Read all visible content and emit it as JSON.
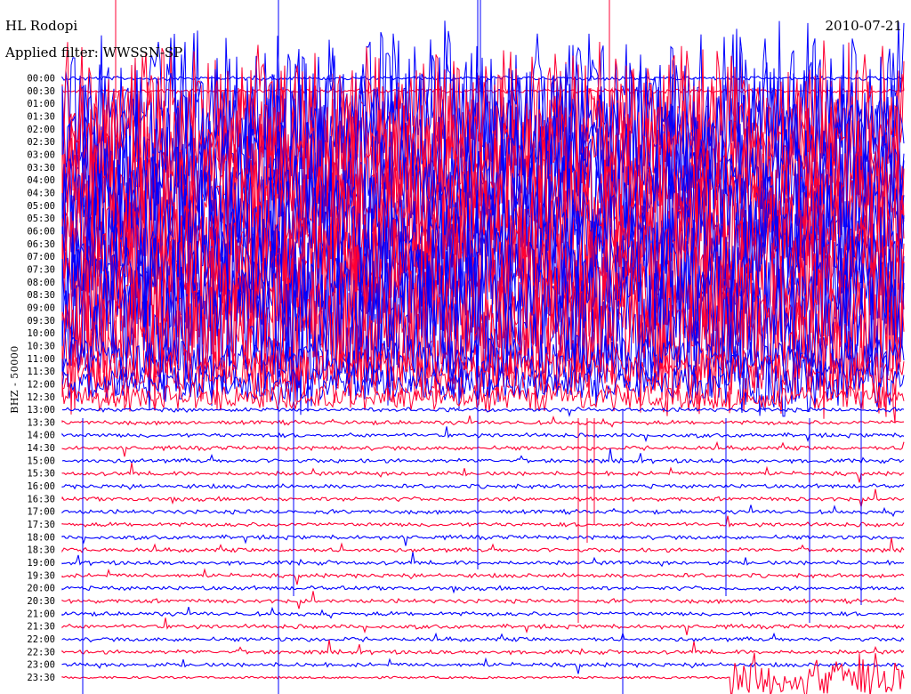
{
  "header": {
    "station": "HL Rodopi",
    "date": "2010-07-21",
    "filter": "Applied filter: WWSSN-SP",
    "channel": "BHZ - 50000"
  },
  "colors": {
    "odd_trace": "#0000ff",
    "even_trace": "#ff0033",
    "text": "#000000"
  },
  "chart_data": {
    "type": "line",
    "title": "HL Rodopi",
    "subtitle": "Applied filter: WWSSN-SP",
    "date": "2010-07-21",
    "ylabel": "BHZ - 50000",
    "rows": [
      "00:00",
      "00:30",
      "01:00",
      "01:30",
      "02:00",
      "02:30",
      "03:00",
      "03:30",
      "04:00",
      "04:30",
      "05:00",
      "05:30",
      "06:00",
      "06:30",
      "07:00",
      "07:30",
      "08:00",
      "08:30",
      "09:00",
      "09:30",
      "10:00",
      "10:30",
      "11:00",
      "11:30",
      "12:00",
      "12:30",
      "13:00",
      "13:30",
      "14:00",
      "14:30",
      "15:00",
      "15:30",
      "16:00",
      "16:30",
      "17:00",
      "17:30",
      "18:00",
      "18:30",
      "19:00",
      "19:30",
      "20:00",
      "20:30",
      "21:00",
      "21:30",
      "22:00",
      "22:30",
      "23:00",
      "23:30"
    ],
    "row_minutes": 30,
    "trace_colors": [
      "blue",
      "red"
    ],
    "grid": false,
    "activity": [
      {
        "rows": "01:30-11:00",
        "level": "saturated"
      },
      {
        "rows": "11:30-12:30",
        "level": "high"
      },
      {
        "rows": "13:00-23:00",
        "level": "low"
      },
      {
        "rows": "23:30",
        "level": "high-late"
      }
    ]
  }
}
